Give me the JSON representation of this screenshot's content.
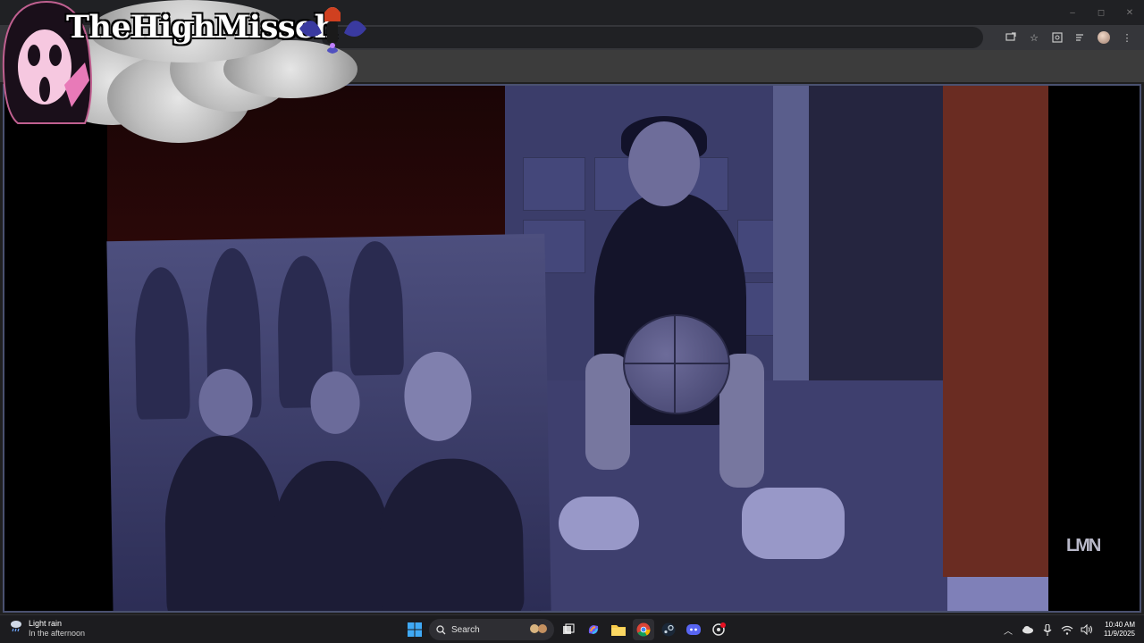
{
  "overlay": {
    "streamer_name": "TheHighMisseh"
  },
  "browser": {
    "window_controls": [
      "–",
      "◻",
      "✕"
    ]
  },
  "video": {
    "watermark": "LMN"
  },
  "taskbar": {
    "weather": {
      "title": "Light rain",
      "subtitle": "In the afternoon"
    },
    "search_label": "Search",
    "pinned_apps": [
      "start",
      "search",
      "widgets",
      "task-view",
      "copilot",
      "file-explorer",
      "chrome",
      "steam",
      "discord",
      "another-app"
    ],
    "clock": {
      "time": "10:40 AM",
      "date": "11/9/2025"
    }
  },
  "colors": {
    "chrome_dark": "#202124",
    "video_tint": "#3b3d6a",
    "taskbar": "#1c1c1f",
    "accent_red": "#e81123"
  }
}
